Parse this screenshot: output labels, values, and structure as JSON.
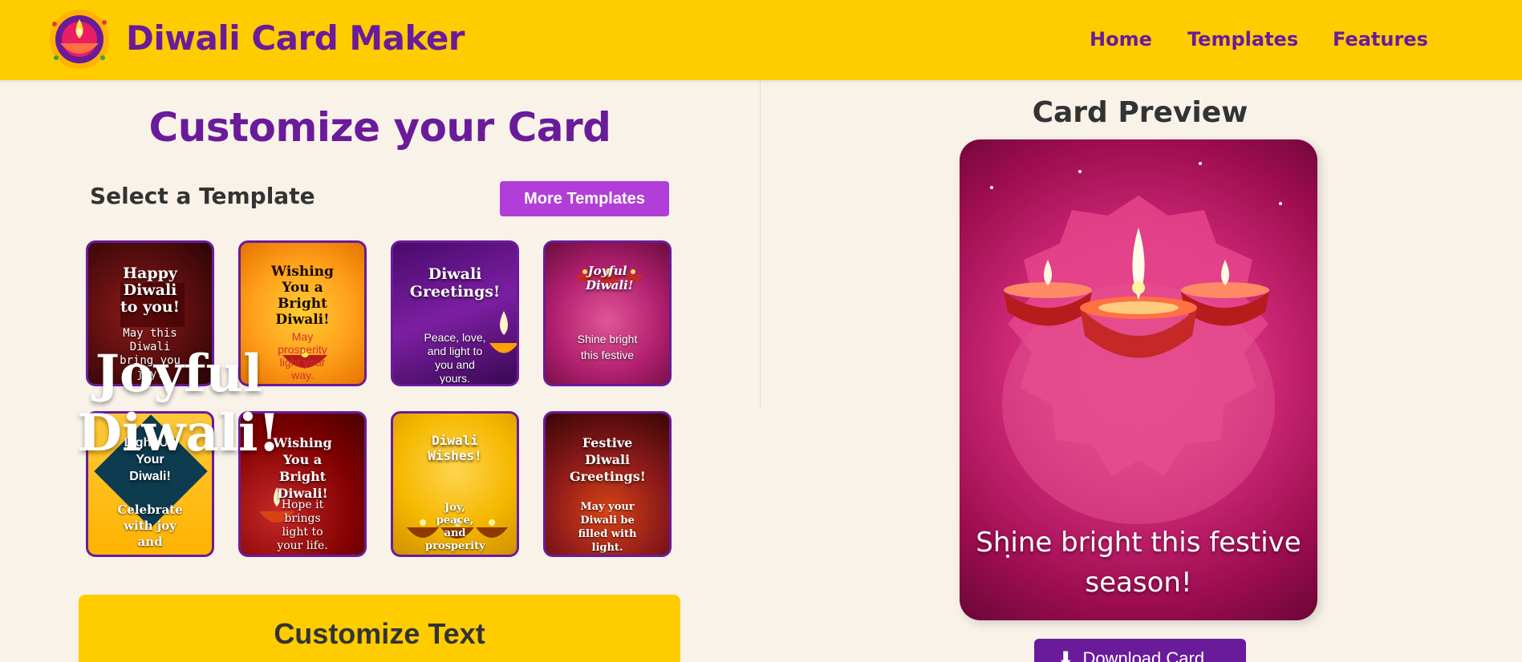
{
  "header": {
    "brand": "Diwali Card Maker",
    "nav": [
      "Home",
      "Templates",
      "Features"
    ]
  },
  "left": {
    "title": "Customize your Card",
    "select_heading": "Select a Template",
    "more_button": "More Templates",
    "templates": [
      {
        "title": "Happy Diwali to you!",
        "message": "May this Diwali bring you joy!"
      },
      {
        "title": "Wishing You a Bright Diwali!",
        "message": "May prosperity light your way."
      },
      {
        "title": "Diwali Greetings!",
        "message": "Peace, love, and light to you and yours."
      },
      {
        "title": "Joyful Diwali!",
        "message": "Shine bright this festive"
      },
      {
        "title": "Light Up Your Diwali!",
        "message": "Celebrate with joy and"
      },
      {
        "title": "Wishing You a Bright Diwali!",
        "message": "Hope it brings light to your life."
      },
      {
        "title": "Diwali Wishes!",
        "message": "Joy, peace, and prosperity to you."
      },
      {
        "title": "Festive Diwali Greetings!",
        "message": "May your Diwali be filled with light."
      }
    ],
    "customize_text_heading": "Customize Text"
  },
  "right": {
    "preview_heading": "Card Preview",
    "card_title_line1": "Joyful",
    "card_title_line2": "Diwali!",
    "card_message": "Shine bright this festive season!",
    "download_button": "Download Card"
  },
  "colors": {
    "header_bg": "#ffcc00",
    "brand_purple": "#6a1b9a",
    "button_purple": "#b13ed8",
    "page_bg": "#f8f2e9",
    "card_pink": "#c2185b"
  },
  "icons": [
    "diya-logo-icon",
    "download-icon",
    "diya-icon"
  ]
}
